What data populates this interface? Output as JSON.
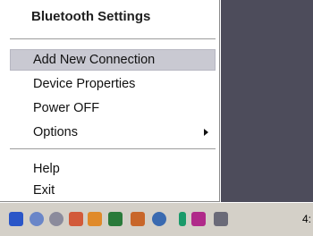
{
  "menu": {
    "title": "Bluetooth Settings",
    "items": [
      {
        "label": "Add New Connection"
      },
      {
        "label": "Device Properties"
      },
      {
        "label": "Power OFF"
      },
      {
        "label": "Options"
      },
      {
        "label": "Help"
      },
      {
        "label": "Exit"
      }
    ]
  },
  "taskbar": {
    "clock": "4:",
    "tray_icons": [
      "bluetooth-icon",
      "network-icon",
      "speaker-icon",
      "tools-icon",
      "butterfly-icon",
      "display-icon",
      "gallery-icon",
      "search-icon",
      "arrow-icon",
      "app-icon",
      "storage-icon"
    ]
  },
  "colors": {
    "desktop": "#4d4c5b",
    "highlight": "#c9c9d2",
    "taskbar": "#d4d0c8"
  }
}
